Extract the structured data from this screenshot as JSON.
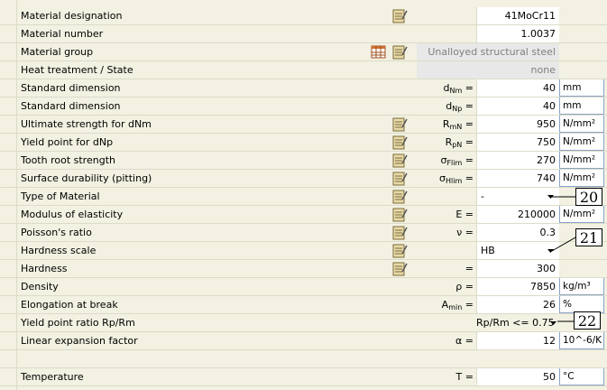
{
  "rows": [
    {
      "label": "Material designation",
      "sym": "",
      "sym_sub": "",
      "val": "41MoCr11",
      "unit": "",
      "icon": "note"
    },
    {
      "label": "Material number",
      "sym": "",
      "sym_sub": "",
      "val": "1.0037",
      "unit": "",
      "icon": ""
    },
    {
      "label": "Material group",
      "sym": "",
      "sym_sub": "",
      "val": "Unalloyed structural steel",
      "unit": "",
      "icon": "table+note"
    },
    {
      "label": "Heat treatment / State",
      "sym": "",
      "sym_sub": "",
      "val": "none",
      "unit": "",
      "icon": ""
    },
    {
      "label": "Standard dimension",
      "sym": "d",
      "sym_sub": "Nm",
      "val": "40",
      "unit": "mm",
      "icon": ""
    },
    {
      "label": "Standard dimension",
      "sym": "d",
      "sym_sub": "Np",
      "val": "40",
      "unit": "mm",
      "icon": ""
    },
    {
      "label": "Ultimate strength for dNm",
      "sym": "R",
      "sym_sub": "mN",
      "val": "950",
      "unit": "N/mm²",
      "icon": "note"
    },
    {
      "label": "Yield point for dNp",
      "sym": "R",
      "sym_sub": "pN",
      "val": "750",
      "unit": "N/mm²",
      "icon": "note"
    },
    {
      "label": "Tooth root strength",
      "sym": "σ",
      "sym_sub": "Flim",
      "val": "270",
      "unit": "N/mm²",
      "icon": "note"
    },
    {
      "label": "Surface durability (pitting)",
      "sym": "σ",
      "sym_sub": "Hlim",
      "val": "740",
      "unit": "N/mm²",
      "icon": "note"
    },
    {
      "label": "Type of Material",
      "sym": "",
      "sym_sub": "",
      "val": "-",
      "unit": "",
      "icon": "note"
    },
    {
      "label": "Modulus of elasticity",
      "sym": "E",
      "sym_sub": "",
      "val": "210000",
      "unit": "N/mm²",
      "icon": "note"
    },
    {
      "label": "Poisson's ratio",
      "sym": "ν",
      "sym_sub": "",
      "val": "0.3",
      "unit": "",
      "icon": "note"
    },
    {
      "label": "Hardness scale",
      "sym": "",
      "sym_sub": "",
      "val": "HB",
      "unit": "",
      "icon": "note"
    },
    {
      "label": "Hardness",
      "sym": "",
      "sym_sub": "",
      "val": "300",
      "unit": "",
      "icon": "note"
    },
    {
      "label": "Density",
      "sym": "ρ",
      "sym_sub": "",
      "val": "7850",
      "unit": "kg/m³",
      "icon": ""
    },
    {
      "label": "Elongation at break",
      "sym": "A",
      "sym_sub": "min",
      "val": "26",
      "unit": "%",
      "icon": ""
    },
    {
      "label": "Yield point ratio Rp/Rm",
      "sym": "",
      "sym_sub": "",
      "val": "Rp/Rm <= 0.75",
      "unit": "",
      "icon": ""
    },
    {
      "label": "Linear expansion factor",
      "sym": "α",
      "sym_sub": "",
      "val": "12",
      "unit": "10^-6/K",
      "icon": ""
    },
    {
      "label": "Temperature",
      "sym": "T",
      "sym_sub": "",
      "val": "50",
      "unit": "°C",
      "icon": ""
    }
  ],
  "callouts": {
    "c20": "20",
    "c21": "21",
    "c22": "22"
  },
  "colors": {
    "background": "#f2f1e2",
    "field": "#ffffff",
    "disabled": "#e8e8e8",
    "unit_border": "#8ba3c7"
  }
}
